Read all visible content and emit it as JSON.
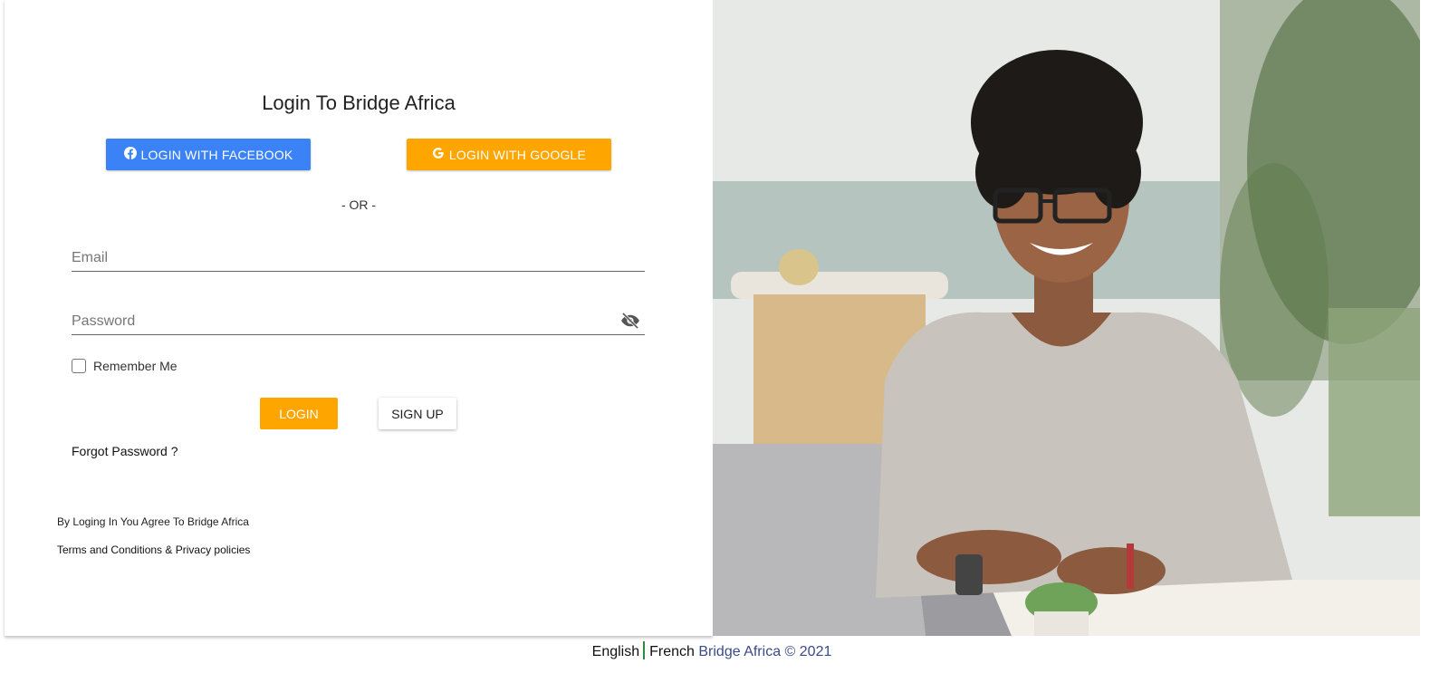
{
  "login": {
    "title": "Login To Bridge Africa",
    "facebook_label": "LOGIN WITH FACEBOOK",
    "google_label": "LOGIN WITH GOOGLE",
    "or_text": "- OR -",
    "email_placeholder": "Email",
    "password_placeholder": "Password",
    "remember_label": "Remember Me",
    "login_label": "LOGIN",
    "signup_label": "SIGN UP",
    "forgot_label": "Forgot Password ?",
    "agree_text": "By Loging In You Agree To Bridge Africa",
    "terms_text": "Terms and Conditions & Privacy policies"
  },
  "footer": {
    "english": "English",
    "french": "French",
    "brand": "Bridge Africa © 2021"
  },
  "colors": {
    "facebook": "#3b82f6",
    "accent": "#ffa500",
    "separator": "#2e8b3e",
    "brand_text": "#3b4a8a"
  },
  "icons": {
    "facebook": "facebook-icon",
    "google": "google-icon",
    "password_visibility": "eye-off-icon"
  },
  "photo": {
    "subject": "woman-with-laptop"
  }
}
